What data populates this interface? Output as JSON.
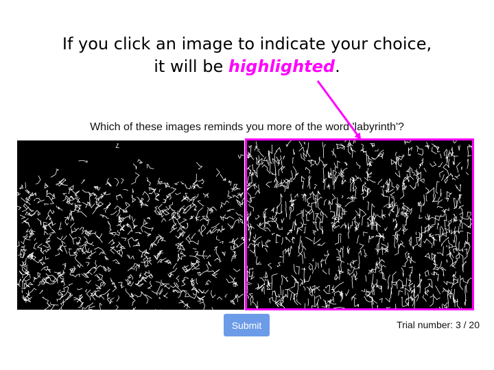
{
  "callout": {
    "line1": "If you click an image to indicate your choice,",
    "line2_prefix": "it will be ",
    "highlight_word": "highlighted",
    "line2_suffix": ".",
    "highlight_color": "#ff00ff"
  },
  "question": "Which of these images reminds you more of the word 'labyrinth'?",
  "images": {
    "left": {
      "selected": false
    },
    "right": {
      "selected": true
    }
  },
  "submit_label": "Submit",
  "trial": {
    "label": "Trial number:",
    "current": 3,
    "total": 20,
    "text": "3 / 20"
  },
  "colors": {
    "highlight": "#ff00ff",
    "button": "#6c9be8"
  }
}
